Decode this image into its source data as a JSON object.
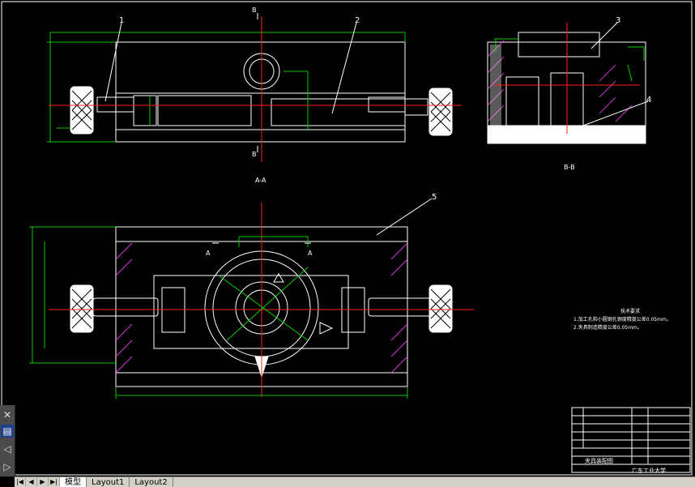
{
  "drawing": {
    "balloons": [
      "1",
      "2",
      "3",
      "4",
      "5"
    ],
    "section_marks": [
      "B",
      "B",
      "A",
      "A"
    ],
    "view_labels": [
      "A-A",
      "B-B"
    ],
    "notes_title": "技术要求",
    "notes": [
      "1.加工孔和小圆钢孔钢度精度公差0.05mm。",
      "2.夹具制造精度公差0.05mm。"
    ],
    "title_block": {
      "drawing_title": "夹具装配图",
      "school": "广东工业大学"
    }
  },
  "left_toolbar": {
    "tools": [
      "close-icon",
      "layers-icon",
      "arrow-left-icon",
      "play-icon"
    ]
  },
  "layout_tabs": {
    "nav": [
      "|◀",
      "◀",
      "▶",
      "▶|"
    ],
    "tabs": [
      {
        "label": "模型",
        "active": true
      },
      {
        "label": "Layout1",
        "active": false
      },
      {
        "label": "Layout2",
        "active": false
      }
    ]
  },
  "colors": {
    "background": "#000000",
    "lines": "#ffffff",
    "centerline": "#ff2020",
    "dimension": "#00cc00",
    "hatch": "#ff40ff",
    "annotation": "#ffff00"
  }
}
